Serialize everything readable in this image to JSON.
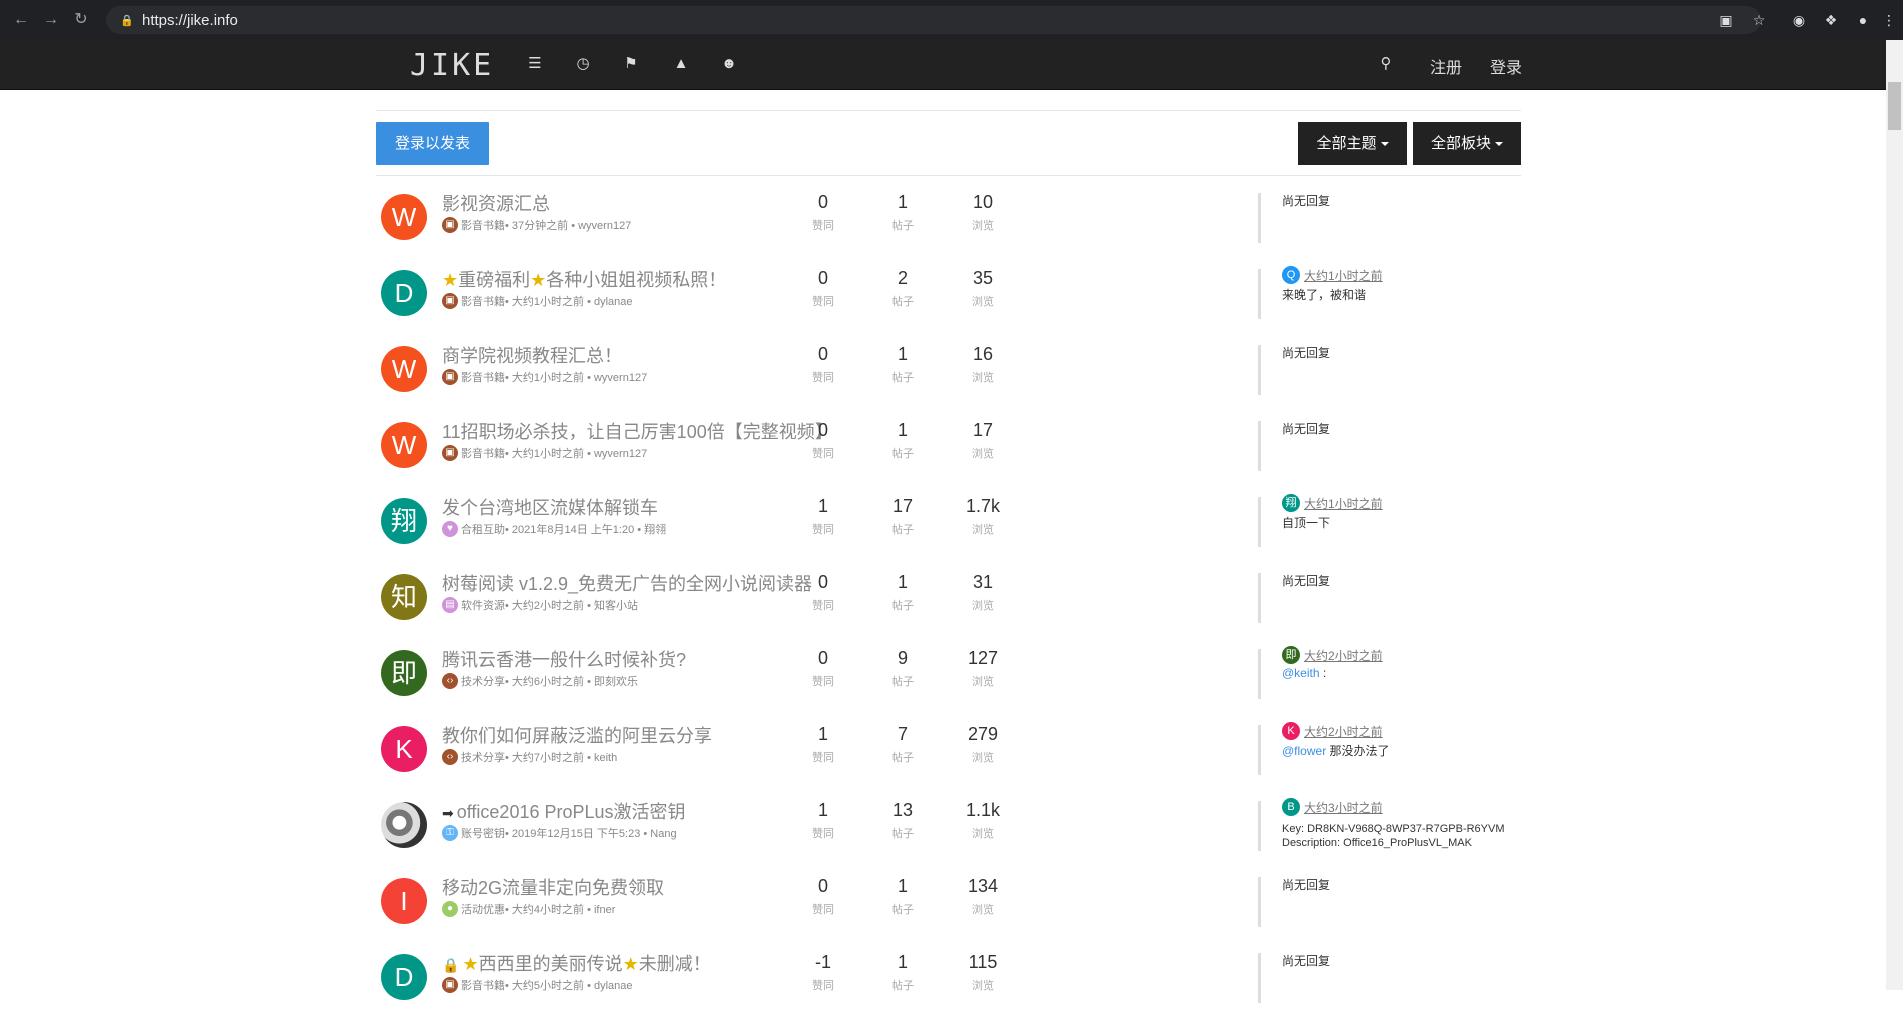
{
  "browser": {
    "url": "https://jike.info",
    "back_icon": "arrow-left-icon",
    "forward_icon": "arrow-right-icon",
    "reload_icon": "reload-icon"
  },
  "nav": {
    "brand": "JIKE",
    "icons": [
      "list-icon",
      "clock-icon",
      "tags-icon",
      "fire-icon",
      "user-icon"
    ],
    "search_icon": "search-icon",
    "register": "注册",
    "login": "登录"
  },
  "controls": {
    "new_topic": "登录以发表",
    "all_topics": "全部主题",
    "all_categories": "全部板块"
  },
  "stat_labels": {
    "votes": "赞同",
    "posts": "帖子",
    "views": "浏览"
  },
  "colors": {
    "accent": "#3a8fe0",
    "navbar": "#222222"
  },
  "topics": [
    {
      "avatar": "W",
      "avatar_color": "#f4511e",
      "title": "影视资源汇总",
      "star_before": false,
      "star_middle": false,
      "prefix_icon": "",
      "category": "影音书籍",
      "cat_color": "#a0522d",
      "cat_icon": "film-icon",
      "meta": " • 37分钟之前 • wyvern127",
      "votes": "0",
      "posts": "1",
      "views": "10",
      "last": {
        "type": "none",
        "text": "尚无回复"
      }
    },
    {
      "avatar": "D",
      "avatar_color": "#009688",
      "title_parts": [
        "重磅福利",
        "各种小姐姐视频私照！"
      ],
      "stars": true,
      "category": "影音书籍",
      "cat_color": "#a0522d",
      "cat_icon": "film-icon",
      "meta": " • 大约1小时之前 • dylanae",
      "votes": "0",
      "posts": "2",
      "views": "35",
      "last": {
        "type": "reply",
        "mini": "Q",
        "mini_color": "#2196f3",
        "time": "大约1小时之前",
        "text": "来晚了，被和谐"
      }
    },
    {
      "avatar": "W",
      "avatar_color": "#f4511e",
      "title": "商学院视频教程汇总！",
      "category": "影音书籍",
      "cat_color": "#a0522d",
      "cat_icon": "film-icon",
      "meta": " • 大约1小时之前 • wyvern127",
      "votes": "0",
      "posts": "1",
      "views": "16",
      "last": {
        "type": "none",
        "text": "尚无回复"
      }
    },
    {
      "avatar": "W",
      "avatar_color": "#f4511e",
      "title": "11招职场必杀技，让自己厉害100倍【完整视频】",
      "category": "影音书籍",
      "cat_color": "#a0522d",
      "cat_icon": "film-icon",
      "meta": " • 大约1小时之前 • wyvern127",
      "votes": "0",
      "posts": "1",
      "views": "17",
      "last": {
        "type": "none",
        "text": "尚无回复"
      }
    },
    {
      "avatar": "翔",
      "avatar_color": "#009688",
      "title": "发个台湾地区流媒体解锁车",
      "category": "合租互助",
      "cat_color": "#ce93d8",
      "cat_icon": "heart-icon",
      "meta": " • 2021年8月14日 上午1:20 • 翔翎",
      "votes": "1",
      "posts": "17",
      "views": "1.7k",
      "last": {
        "type": "reply",
        "mini": "翔",
        "mini_color": "#009688",
        "time": "大约1小时之前",
        "text": "自顶一下"
      }
    },
    {
      "avatar": "知",
      "avatar_color": "#827717",
      "title": "树莓阅读 v1.2.9_免费无广告的全网小说阅读器",
      "category": "软件资源",
      "cat_color": "#ce93d8",
      "cat_icon": "file-icon",
      "meta": " • 大约2小时之前 • 知客小站",
      "votes": "0",
      "posts": "1",
      "views": "31",
      "last": {
        "type": "none",
        "text": "尚无回复"
      }
    },
    {
      "avatar": "即",
      "avatar_color": "#33691e",
      "title": "腾讯云香港一般什么时候补货?",
      "category": "技术分享",
      "cat_color": "#a0522d",
      "cat_icon": "code-icon",
      "meta": " • 大约6小时之前 • 即刻欢乐",
      "votes": "0",
      "posts": "9",
      "views": "127",
      "last": {
        "type": "reply",
        "mini": "即",
        "mini_color": "#33691e",
        "time": "大约2小时之前",
        "mention": "@keith",
        "text": " :"
      }
    },
    {
      "avatar": "K",
      "avatar_color": "#e91e63",
      "title": "教你们如何屏蔽泛滥的阿里云分享",
      "category": "技术分享",
      "cat_color": "#a0522d",
      "cat_icon": "code-icon",
      "meta": " • 大约7小时之前 • keith",
      "votes": "1",
      "posts": "7",
      "views": "279",
      "last": {
        "type": "reply",
        "mini": "K",
        "mini_color": "#e91e63",
        "time": "大约2小时之前",
        "mention": "@flower",
        "text": " 那没办法了"
      }
    },
    {
      "avatar": "",
      "avatar_color": "#777777",
      "photo": true,
      "title": "office2016 ProPLus激活密钥",
      "prefix": "arrow-circle-icon",
      "category": "账号密钥",
      "cat_color": "#64b5f6",
      "cat_icon": "key-icon",
      "meta": " • 2019年12月15日 下午5:23 • Nang",
      "votes": "1",
      "posts": "13",
      "views": "1.1k",
      "last": {
        "type": "reply",
        "mini": "B",
        "mini_color": "#009688",
        "time": "大约3小时之前",
        "line1": "Key: DR8KN-V968Q-8WP37-R7GPB-R6YVM",
        "line2": "Description: Office16_ProPlusVL_MAK"
      }
    },
    {
      "avatar": "I",
      "avatar_color": "#f44336",
      "title": "移动2G流量非定向免费领取",
      "category": "活动优惠",
      "cat_color": "#9ccc65",
      "cat_icon": "comment-icon",
      "meta": " • 大约4小时之前 • ifner",
      "votes": "0",
      "posts": "1",
      "views": "134",
      "last": {
        "type": "none",
        "text": "尚无回复"
      }
    },
    {
      "avatar": "D",
      "avatar_color": "#009688",
      "title_parts": [
        "西西里的美丽传说",
        "未删减！"
      ],
      "stars": true,
      "lock": true,
      "category": "影音书籍",
      "cat_color": "#a0522d",
      "cat_icon": "film-icon",
      "meta": " • 大约5小时之前 • dylanae",
      "votes": "-1",
      "posts": "1",
      "views": "115",
      "last": {
        "type": "none",
        "text": "尚无回复"
      }
    }
  ]
}
